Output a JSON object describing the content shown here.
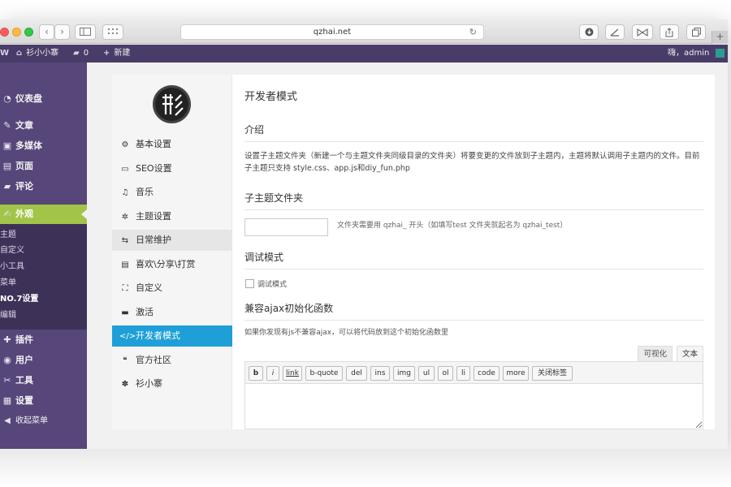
{
  "browser": {
    "url": "qzhai.net",
    "reload_icon": "↻",
    "back_icon": "‹",
    "forward_icon": "›",
    "new_tab_icon": "+"
  },
  "adminbar": {
    "wp_logo": "W",
    "site_name": "衫小小寨",
    "comments_count": "0",
    "new_label": "新建",
    "greeting": "嗨，admin"
  },
  "sidebar": {
    "items": [
      {
        "label": "仪表盘",
        "icon": "dashboard-icon",
        "glyph": "◔"
      },
      {
        "label": "文章",
        "icon": "pin-icon",
        "glyph": "✎"
      },
      {
        "label": "多媒体",
        "icon": "media-icon",
        "glyph": "▣"
      },
      {
        "label": "页面",
        "icon": "page-icon",
        "glyph": "▤"
      },
      {
        "label": "评论",
        "icon": "comment-icon",
        "glyph": "▰"
      },
      {
        "label": "外观",
        "icon": "brush-icon",
        "glyph": "✍"
      },
      {
        "label": "插件",
        "icon": "plugin-icon",
        "glyph": "✚"
      },
      {
        "label": "用户",
        "icon": "user-icon",
        "glyph": "◉"
      },
      {
        "label": "工具",
        "icon": "wrench-icon",
        "glyph": "✂"
      },
      {
        "label": "设置",
        "icon": "settings-icon",
        "glyph": "▦"
      },
      {
        "label": "收起菜单",
        "icon": "collapse-icon",
        "glyph": "◀"
      }
    ],
    "submenu": [
      "主题",
      "自定义",
      "小工具",
      "菜单",
      "NO.7设置",
      "编辑"
    ]
  },
  "panel_nav": {
    "items": [
      {
        "label": "基本设置",
        "icon": "cogs-icon",
        "glyph": "⚙"
      },
      {
        "label": "SEO设置",
        "icon": "desktop-icon",
        "glyph": "▭"
      },
      {
        "label": "音乐",
        "icon": "music-icon",
        "glyph": "♫"
      },
      {
        "label": "主题设置",
        "icon": "gear-icon",
        "glyph": "✲"
      },
      {
        "label": "日常维护",
        "icon": "refresh-icon",
        "glyph": "⇆"
      },
      {
        "label": "喜欢\\分享\\打赏",
        "icon": "list-icon",
        "glyph": "▤"
      },
      {
        "label": "自定义",
        "icon": "expand-icon",
        "glyph": "⛶"
      },
      {
        "label": "激活",
        "icon": "card-icon",
        "glyph": "▬"
      },
      {
        "label": "开发者模式",
        "icon": "code-icon",
        "glyph": "</>"
      },
      {
        "label": "官方社区",
        "icon": "quote-icon",
        "glyph": "❝"
      },
      {
        "label": "衫小寨",
        "icon": "paw-icon",
        "glyph": "✽"
      }
    ]
  },
  "main": {
    "title": "开发者模式",
    "intro_heading": "介绍",
    "intro_text": "设置子主题文件夹（新建一个与主题文件夹同级目录的文件夹）将要变更的文件放到子主题内，主题将默认调用子主题内的文件。目前子主题只支持 style.css、app.js和diy_fun.php",
    "child_heading": "子主题文件夹",
    "child_input_value": "",
    "child_hint": "文件夹需要用 qzhai_ 开头（如填写test 文件夹就起名为 qzhai_test）",
    "debug_heading": "调试模式",
    "debug_label": "调试模式",
    "ajax_heading": "兼容ajax初始化函数",
    "ajax_desc": "如果你发现有js不兼容ajax，可以将代码放到这个初始化函数里",
    "tab_visual": "可视化",
    "tab_text": "文本",
    "quicktags": [
      "b",
      "i",
      "link",
      "b-quote",
      "del",
      "ins",
      "img",
      "ul",
      "ol",
      "li",
      "code",
      "more",
      "关闭标签"
    ],
    "textarea_value": ""
  }
}
